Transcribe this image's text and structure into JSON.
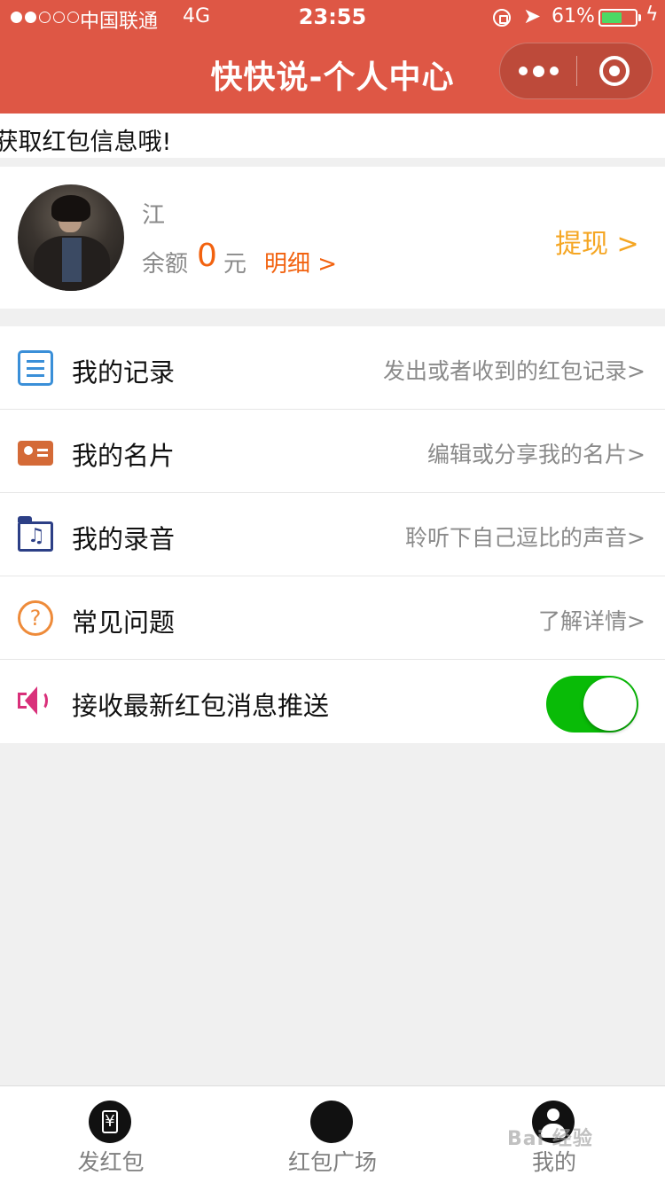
{
  "status_bar": {
    "carrier": "中国联通",
    "network": "4G",
    "time": "23:55",
    "battery_percent": "61%",
    "battery_level": 0.61
  },
  "nav": {
    "title": "快快说-个人中心"
  },
  "marquee": {
    "text": "l获取红包信息哦!"
  },
  "profile": {
    "username": "江",
    "balance_label": "余额",
    "balance_value": "0",
    "balance_unit": "元",
    "detail_link": "明细 >",
    "withdraw_link": "提现 >"
  },
  "menu": {
    "items": [
      {
        "label": "我的记录",
        "desc": "发出或者收到的红包记录>",
        "icon": "record-icon"
      },
      {
        "label": "我的名片",
        "desc": "编辑或分享我的名片>",
        "icon": "card-icon"
      },
      {
        "label": "我的录音",
        "desc": "聆听下自己逗比的声音>",
        "icon": "audio-folder-icon"
      },
      {
        "label": "常见问题",
        "desc": "了解详情>",
        "icon": "question-icon"
      },
      {
        "label": "接收最新红包消息推送",
        "icon": "speaker-icon",
        "toggle_on": true
      }
    ]
  },
  "tabbar": {
    "tabs": [
      {
        "label": "发红包",
        "icon": "red-envelope-icon"
      },
      {
        "label": "红包广场",
        "icon": "grid-icon"
      },
      {
        "label": "我的",
        "icon": "person-icon",
        "active": true
      }
    ]
  },
  "watermark": {
    "text": "Bai 经验"
  },
  "colors": {
    "header": "#de5745",
    "accent_orange": "#f2620f",
    "withdraw": "#f5a623",
    "toggle_on": "#09bb07"
  }
}
